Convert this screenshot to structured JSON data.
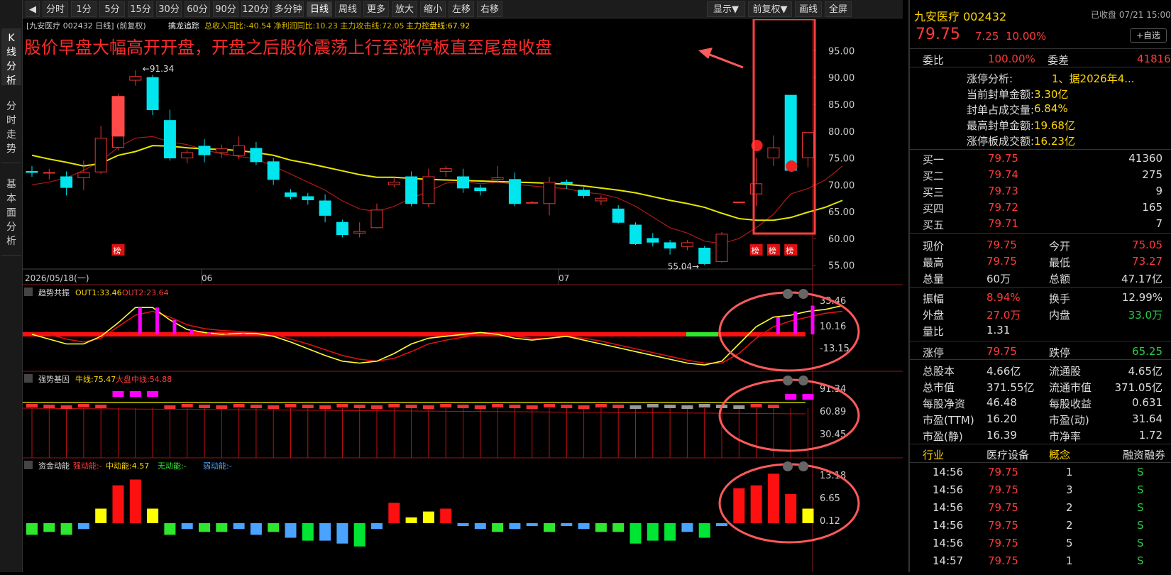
{
  "left_tabs": [
    {
      "label": "K线分析"
    },
    {
      "label": "分时走势"
    },
    {
      "label": "基本面分析"
    }
  ],
  "toolbar": {
    "items": [
      "分时",
      "1分",
      "5分",
      "15分",
      "30分",
      "60分",
      "90分",
      "120分",
      "多分钟",
      "日线",
      "周线",
      "更多▼",
      "放大",
      "缩小",
      "左移",
      "右移"
    ],
    "right_items": [
      "显示▼",
      "前复权▼",
      "画线",
      "全屏"
    ]
  },
  "chart_header": {
    "stock": "[九安医疗 002432 日线]",
    "adjust": "(前复权)",
    "indicator": "擒龙追踪",
    "metrics": "总收入同比:-40.54 净利润同比:10.23 主力攻击线:72.05",
    "control": "主力控盘线:67.92"
  },
  "annotation": "股价早盘大幅高开开盘，开盘之后股价震荡上行至涨停板直至尾盘收盘",
  "price_labels": {
    "high": "91.34",
    "low": "55.04"
  },
  "date_labels": [
    "2026/05/18(一)",
    "06",
    "07"
  ],
  "bang": "榜",
  "panel1": {
    "name": "趋势共振",
    "out1": "OUT1:33.46",
    "out2": "OUT2:23.64",
    "ticks": [
      "33.46",
      "10.16",
      "-13.15"
    ]
  },
  "panel2": {
    "name": "强势基因",
    "bull": "牛线:75.47",
    "market": "大盘中线:54.88",
    "ticks": [
      "91.34",
      "60.89",
      "30.45"
    ]
  },
  "panel3": {
    "name": "资金动能",
    "strong": "强动能:-",
    "mid": "中动能:4.57",
    "none": "无动能:-",
    "weak": "弱动能:-",
    "ticks": [
      "13.18",
      "6.65",
      "0.12"
    ]
  },
  "chart_data": {
    "type": "candlestick",
    "y_ticks": [
      95,
      90,
      85,
      80,
      75,
      70,
      65,
      60,
      55
    ],
    "ylim": [
      53.5,
      98.5
    ],
    "candles": [
      [
        72.5,
        73.5,
        71.5,
        72.3
      ],
      [
        72.3,
        73.0,
        71.0,
        72.3
      ],
      [
        71.5,
        72.5,
        68.0,
        69.5
      ],
      [
        71.3,
        74.5,
        69.0,
        72.3
      ],
      [
        72.4,
        81.0,
        72.0,
        78.7
      ],
      [
        77.0,
        87.0,
        76.5,
        86.5
      ],
      [
        89.5,
        91.34,
        88.5,
        90.2
      ],
      [
        90.0,
        90.5,
        83.0,
        84.0
      ],
      [
        82.0,
        84.0,
        74.5,
        75.0
      ],
      [
        75.0,
        76.5,
        74.0,
        76.0
      ],
      [
        77.2,
        78.5,
        74.2,
        75.6
      ],
      [
        76.0,
        77.5,
        75.0,
        76.7
      ],
      [
        75.5,
        79.0,
        74.8,
        77.3
      ],
      [
        76.8,
        78.0,
        73.7,
        74.3
      ],
      [
        74.3,
        75.0,
        70.0,
        71.0
      ],
      [
        68.5,
        69.2,
        67.3,
        67.8
      ],
      [
        67.8,
        68.5,
        66.3,
        67.2
      ],
      [
        67.0,
        68.2,
        63.0,
        64.3
      ],
      [
        63.0,
        63.5,
        60.2,
        60.7
      ],
      [
        61.0,
        63.0,
        60.2,
        61.3
      ],
      [
        62.0,
        66.5,
        62.0,
        65.3
      ],
      [
        70.0,
        71.4,
        69.5,
        70.5
      ],
      [
        71.5,
        72.5,
        66.0,
        66.5
      ],
      [
        66.5,
        73.0,
        65.8,
        71.5
      ],
      [
        72.5,
        73.5,
        71.5,
        73.0
      ],
      [
        71.5,
        73.0,
        68.5,
        69.4
      ],
      [
        69.4,
        70.0,
        68.0,
        68.9
      ],
      [
        71.0,
        73.5,
        70.3,
        71.3
      ],
      [
        71.0,
        72.3,
        66.0,
        66.5
      ],
      [
        66.7,
        67.0,
        66.5,
        66.7
      ],
      [
        66.5,
        71.5,
        64.3,
        70.5
      ],
      [
        70.5,
        71.0,
        69.2,
        70.2
      ],
      [
        69.0,
        69.5,
        67.5,
        68.0
      ],
      [
        67.0,
        68.0,
        66.2,
        67.5
      ],
      [
        65.5,
        66.2,
        62.8,
        63.0
      ],
      [
        62.5,
        63.0,
        58.8,
        59.0
      ],
      [
        60.0,
        61.0,
        58.5,
        59.3
      ],
      [
        59.2,
        59.7,
        57.0,
        58.2
      ],
      [
        58.5,
        59.7,
        57.8,
        59.2
      ],
      [
        58.2,
        58.6,
        55.04,
        55.3
      ],
      [
        55.7,
        61.2,
        55.5,
        60.8
      ],
      [
        66.8,
        66.8,
        66.8,
        66.8
      ],
      [
        68.3,
        75.0,
        66.0,
        70.2
      ],
      [
        75.0,
        79.2,
        73.5,
        76.9
      ],
      [
        86.7,
        86.7,
        72.7,
        72.7
      ],
      [
        75.05,
        79.75,
        73.27,
        79.75
      ]
    ],
    "ma_yellow_values": [
      75.5,
      74.8,
      74.2,
      73.5,
      74.0,
      75.5,
      76.2,
      77.3,
      77.2,
      76.9,
      76.7,
      76.6,
      76.4,
      76.0,
      75.5,
      74.6,
      74.0,
      73.3,
      72.6,
      71.9,
      71.4,
      71.4,
      71.2,
      71.0,
      70.9,
      70.8,
      70.7,
      70.6,
      70.5,
      70.4,
      70.3,
      70.1,
      69.8,
      69.4,
      69.0,
      68.5,
      67.8,
      67.1,
      66.5,
      65.8,
      64.7,
      63.7,
      63.4,
      63.4,
      63.9,
      64.9,
      65.8,
      67.1
    ],
    "ma_red_values": [
      70.0,
      70.5,
      71.3,
      72.7,
      74.4,
      77.0,
      78.7,
      79.0,
      78.0,
      77.5,
      76.5,
      75.8,
      75.3,
      74.8,
      73.5,
      72.0,
      70.5,
      69.0,
      67.0,
      65.5,
      65.0,
      66.0,
      67.5,
      68.8,
      70.3,
      70.6,
      70.2,
      70.5,
      70.1,
      69.8,
      69.5,
      69.3,
      68.6,
      68.3,
      67.5,
      66.0,
      64.0,
      62.0,
      61.0,
      59.5,
      59.0,
      60.0,
      62.0,
      64.5,
      68.3,
      69.3,
      70.9,
      73.5
    ]
  },
  "right": {
    "title": "九安医疗 002432",
    "status": "已收盘 07/21 15:00",
    "price": "79.75",
    "change": "7.25",
    "pct": "10.00%",
    "fav": "+自选",
    "webi": [
      "委比",
      "100.00%",
      "委差",
      "41816"
    ],
    "analysis": [
      [
        "涨停分析:",
        "1、据2026年4..."
      ],
      [
        "当前封单金额:",
        "3.30亿"
      ],
      [
        "封单占成交量:",
        "6.84%"
      ],
      [
        "最高封单金额:",
        "19.68亿"
      ],
      [
        "涨停板成交额:",
        "16.23亿"
      ]
    ],
    "bids": [
      [
        "买一",
        "79.75",
        "41360"
      ],
      [
        "买二",
        "79.74",
        "275"
      ],
      [
        "买三",
        "79.73",
        "9"
      ],
      [
        "买四",
        "79.72",
        "165"
      ],
      [
        "买五",
        "79.71",
        "7"
      ]
    ],
    "quote": [
      [
        "现价",
        "79.75",
        "今开",
        "75.05"
      ],
      [
        "最高",
        "79.75",
        "最低",
        "73.27"
      ],
      [
        "总量",
        "60万",
        "总额",
        "47.17亿"
      ]
    ],
    "quote2": [
      [
        "振幅",
        "8.94%",
        "换手",
        "12.99%"
      ],
      [
        "外盘",
        "27.0万",
        "内盘",
        "33.0万"
      ],
      [
        "量比",
        "1.31",
        "",
        ""
      ]
    ],
    "limits": [
      "涨停",
      "79.75",
      "跌停",
      "65.25"
    ],
    "fund": [
      [
        "总股本",
        "4.66亿",
        "流通股",
        "4.65亿"
      ],
      [
        "总市值",
        "371.55亿",
        "流通市值",
        "371.05亿"
      ],
      [
        "每股净资",
        "46.48",
        "每股收益",
        "0.631"
      ],
      [
        "市盈(TTM)",
        "16.20",
        "市盈(动)",
        "31.64"
      ],
      [
        "市盈(静)",
        "16.39",
        "市净率",
        "1.72"
      ]
    ],
    "tabs": [
      "行业",
      "医疗设备",
      "概念",
      "融资融券"
    ],
    "ticks": [
      [
        "14:56",
        "79.75",
        "1",
        "S"
      ],
      [
        "14:56",
        "79.75",
        "3",
        "S"
      ],
      [
        "14:56",
        "79.75",
        "2",
        "S"
      ],
      [
        "14:56",
        "79.75",
        "2",
        "S"
      ],
      [
        "14:56",
        "79.75",
        "5",
        "S"
      ],
      [
        "14:57",
        "79.75",
        "1",
        "S"
      ]
    ]
  }
}
